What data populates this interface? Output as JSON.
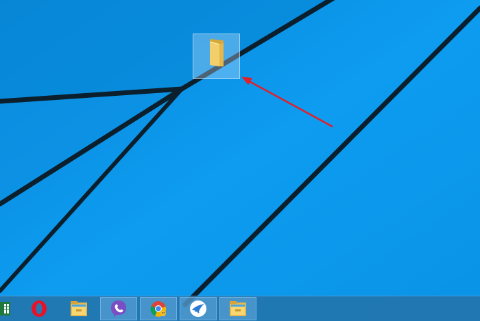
{
  "desktop": {
    "wallpaper": "windows-10-hero-lines",
    "background_color": "#0a8fe0",
    "icons": [
      {
        "name": "folder-icon",
        "label": "",
        "selected": true
      }
    ]
  },
  "annotation": {
    "arrow_color": "#e0202a"
  },
  "taskbar": {
    "buttons": [
      {
        "icon": "excel-icon",
        "active": false
      },
      {
        "icon": "opera-icon",
        "active": false
      },
      {
        "icon": "file-explorer-icon",
        "active": false
      },
      {
        "icon": "viber-icon",
        "active": true
      },
      {
        "icon": "chrome-icon",
        "active": true
      },
      {
        "icon": "swift-bird-icon",
        "active": true
      },
      {
        "icon": "file-explorer-icon",
        "active": true
      }
    ]
  }
}
